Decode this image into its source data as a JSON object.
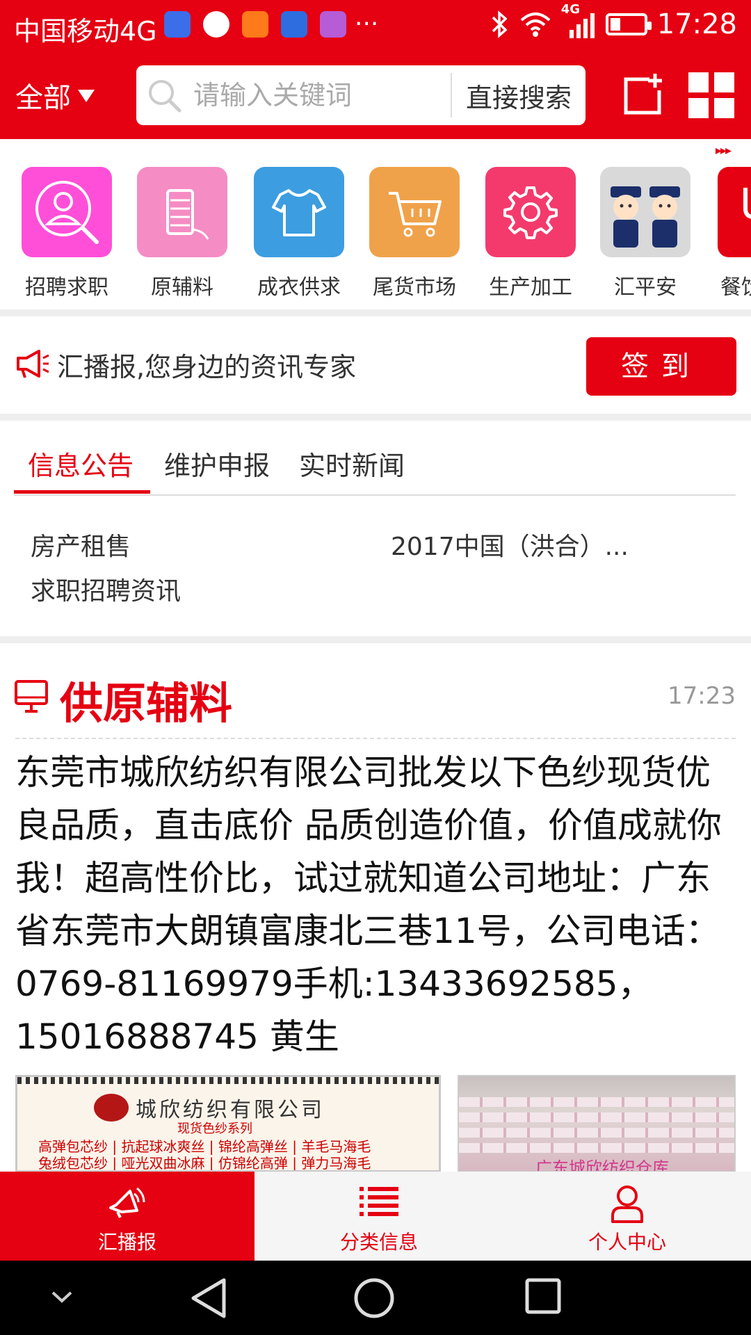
{
  "status_bar": {
    "carrier": "中国移动4G",
    "time": "17:28",
    "network": "4G",
    "overflow": "···",
    "notification_icons": [
      "baidu-app-icon",
      "ball-app-icon",
      "heart-app-icon",
      "chat-app-icon",
      "gallery-app-icon"
    ]
  },
  "header": {
    "scope_label": "全部",
    "search_placeholder": "请输入关键词",
    "search_button": "直接搜索"
  },
  "categories": {
    "more_arrows": "▸▸▸",
    "items": [
      {
        "label": "招聘求职",
        "icon": "person-search-icon",
        "color": "#ff4fd8"
      },
      {
        "label": "原辅料",
        "icon": "yarn-spool-icon",
        "color": "#f58cc4"
      },
      {
        "label": "成衣供求",
        "icon": "shirt-icon",
        "color": "#3c9de0"
      },
      {
        "label": "尾货市场",
        "icon": "shopping-cart-icon",
        "color": "#f0a24a"
      },
      {
        "label": "生产加工",
        "icon": "gear-icon",
        "color": "#f43a6c"
      },
      {
        "label": "汇平安",
        "icon": "police-cartoon-icon",
        "color": "#d9d9d9"
      },
      {
        "label": "餐饮",
        "icon": "fork-icon",
        "color": "#e50012"
      }
    ]
  },
  "notice": {
    "text": "汇播报,您身边的资讯专家",
    "signin_label": "签到"
  },
  "tabs": {
    "items": [
      "信息公告",
      "维护申报",
      "实时新闻"
    ],
    "active_index": 0,
    "links": [
      "房产租售",
      "2017中国（洪合）...",
      "求职招聘资讯"
    ]
  },
  "article": {
    "category": "供原辅料",
    "time": "17:23",
    "body": "东莞市城欣纺织有限公司批发以下色纱现货优良品质，直击底价 品质创造价值，价值成就你我！超高性价比，试过就知道公司地址：广东省东莞市大朗镇富康北三巷11号，公司电话：0769-81169979手机:13433692585，15016888745 黄生",
    "image1": {
      "company": "城欣纺织有限公司",
      "series": "现货色纱系列",
      "line1": "高弹包芯纱 | 抗起球冰爽丝 | 锦纶高弹丝 | 羊毛马海毛",
      "line2": "兔绒包芯纱 | 哑光双曲冰麻 | 仿锦纶高弹 | 弹力马海毛"
    },
    "image2": {
      "caption": "广东城欣纺织仓库"
    }
  },
  "bottom_nav": {
    "items": [
      {
        "label": "汇播报",
        "icon": "broadcast-icon"
      },
      {
        "label": "分类信息",
        "icon": "list-icon"
      },
      {
        "label": "个人中心",
        "icon": "user-icon"
      }
    ],
    "active_index": 0
  },
  "colors": {
    "brand_red": "#e50012",
    "text": "#333333",
    "muted": "#999999"
  }
}
